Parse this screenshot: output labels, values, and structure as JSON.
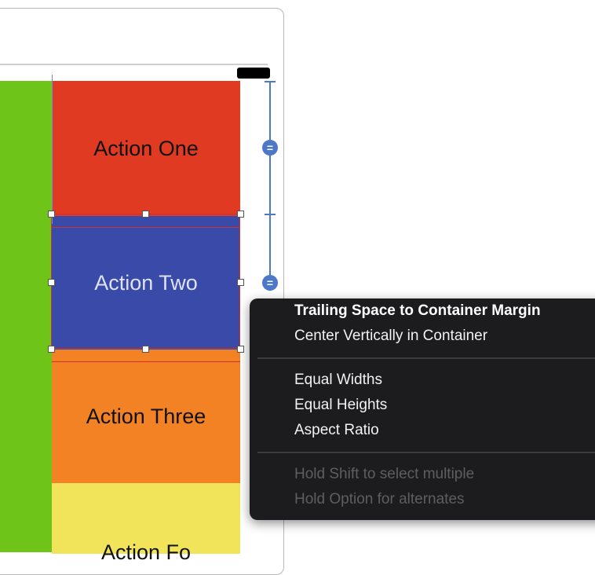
{
  "canvas": {
    "actions": [
      {
        "label": "Action One"
      },
      {
        "label": "Action Two"
      },
      {
        "label": "Action Three"
      },
      {
        "label": "Action Fo"
      }
    ]
  },
  "context_menu": {
    "groups": [
      {
        "items": [
          {
            "label": "Trailing Space to Container Margin",
            "state": "highlighted"
          },
          {
            "label": "Center Vertically in Container"
          }
        ]
      },
      {
        "items": [
          {
            "label": "Equal Widths"
          },
          {
            "label": "Equal Heights"
          },
          {
            "label": "Aspect Ratio"
          }
        ]
      },
      {
        "items": [
          {
            "label": "Hold Shift to select multiple",
            "state": "disabled"
          },
          {
            "label": "Hold Option for alternates",
            "state": "disabled"
          }
        ]
      }
    ]
  },
  "colors": {
    "green_view": "#6fc41a",
    "action_one": "#e03a22",
    "action_two": "#3a4aa8",
    "action_three": "#f28224",
    "action_four": "#f2e45a",
    "constraint": "#4b78c7",
    "menu_bg": "#1c1c1e"
  }
}
